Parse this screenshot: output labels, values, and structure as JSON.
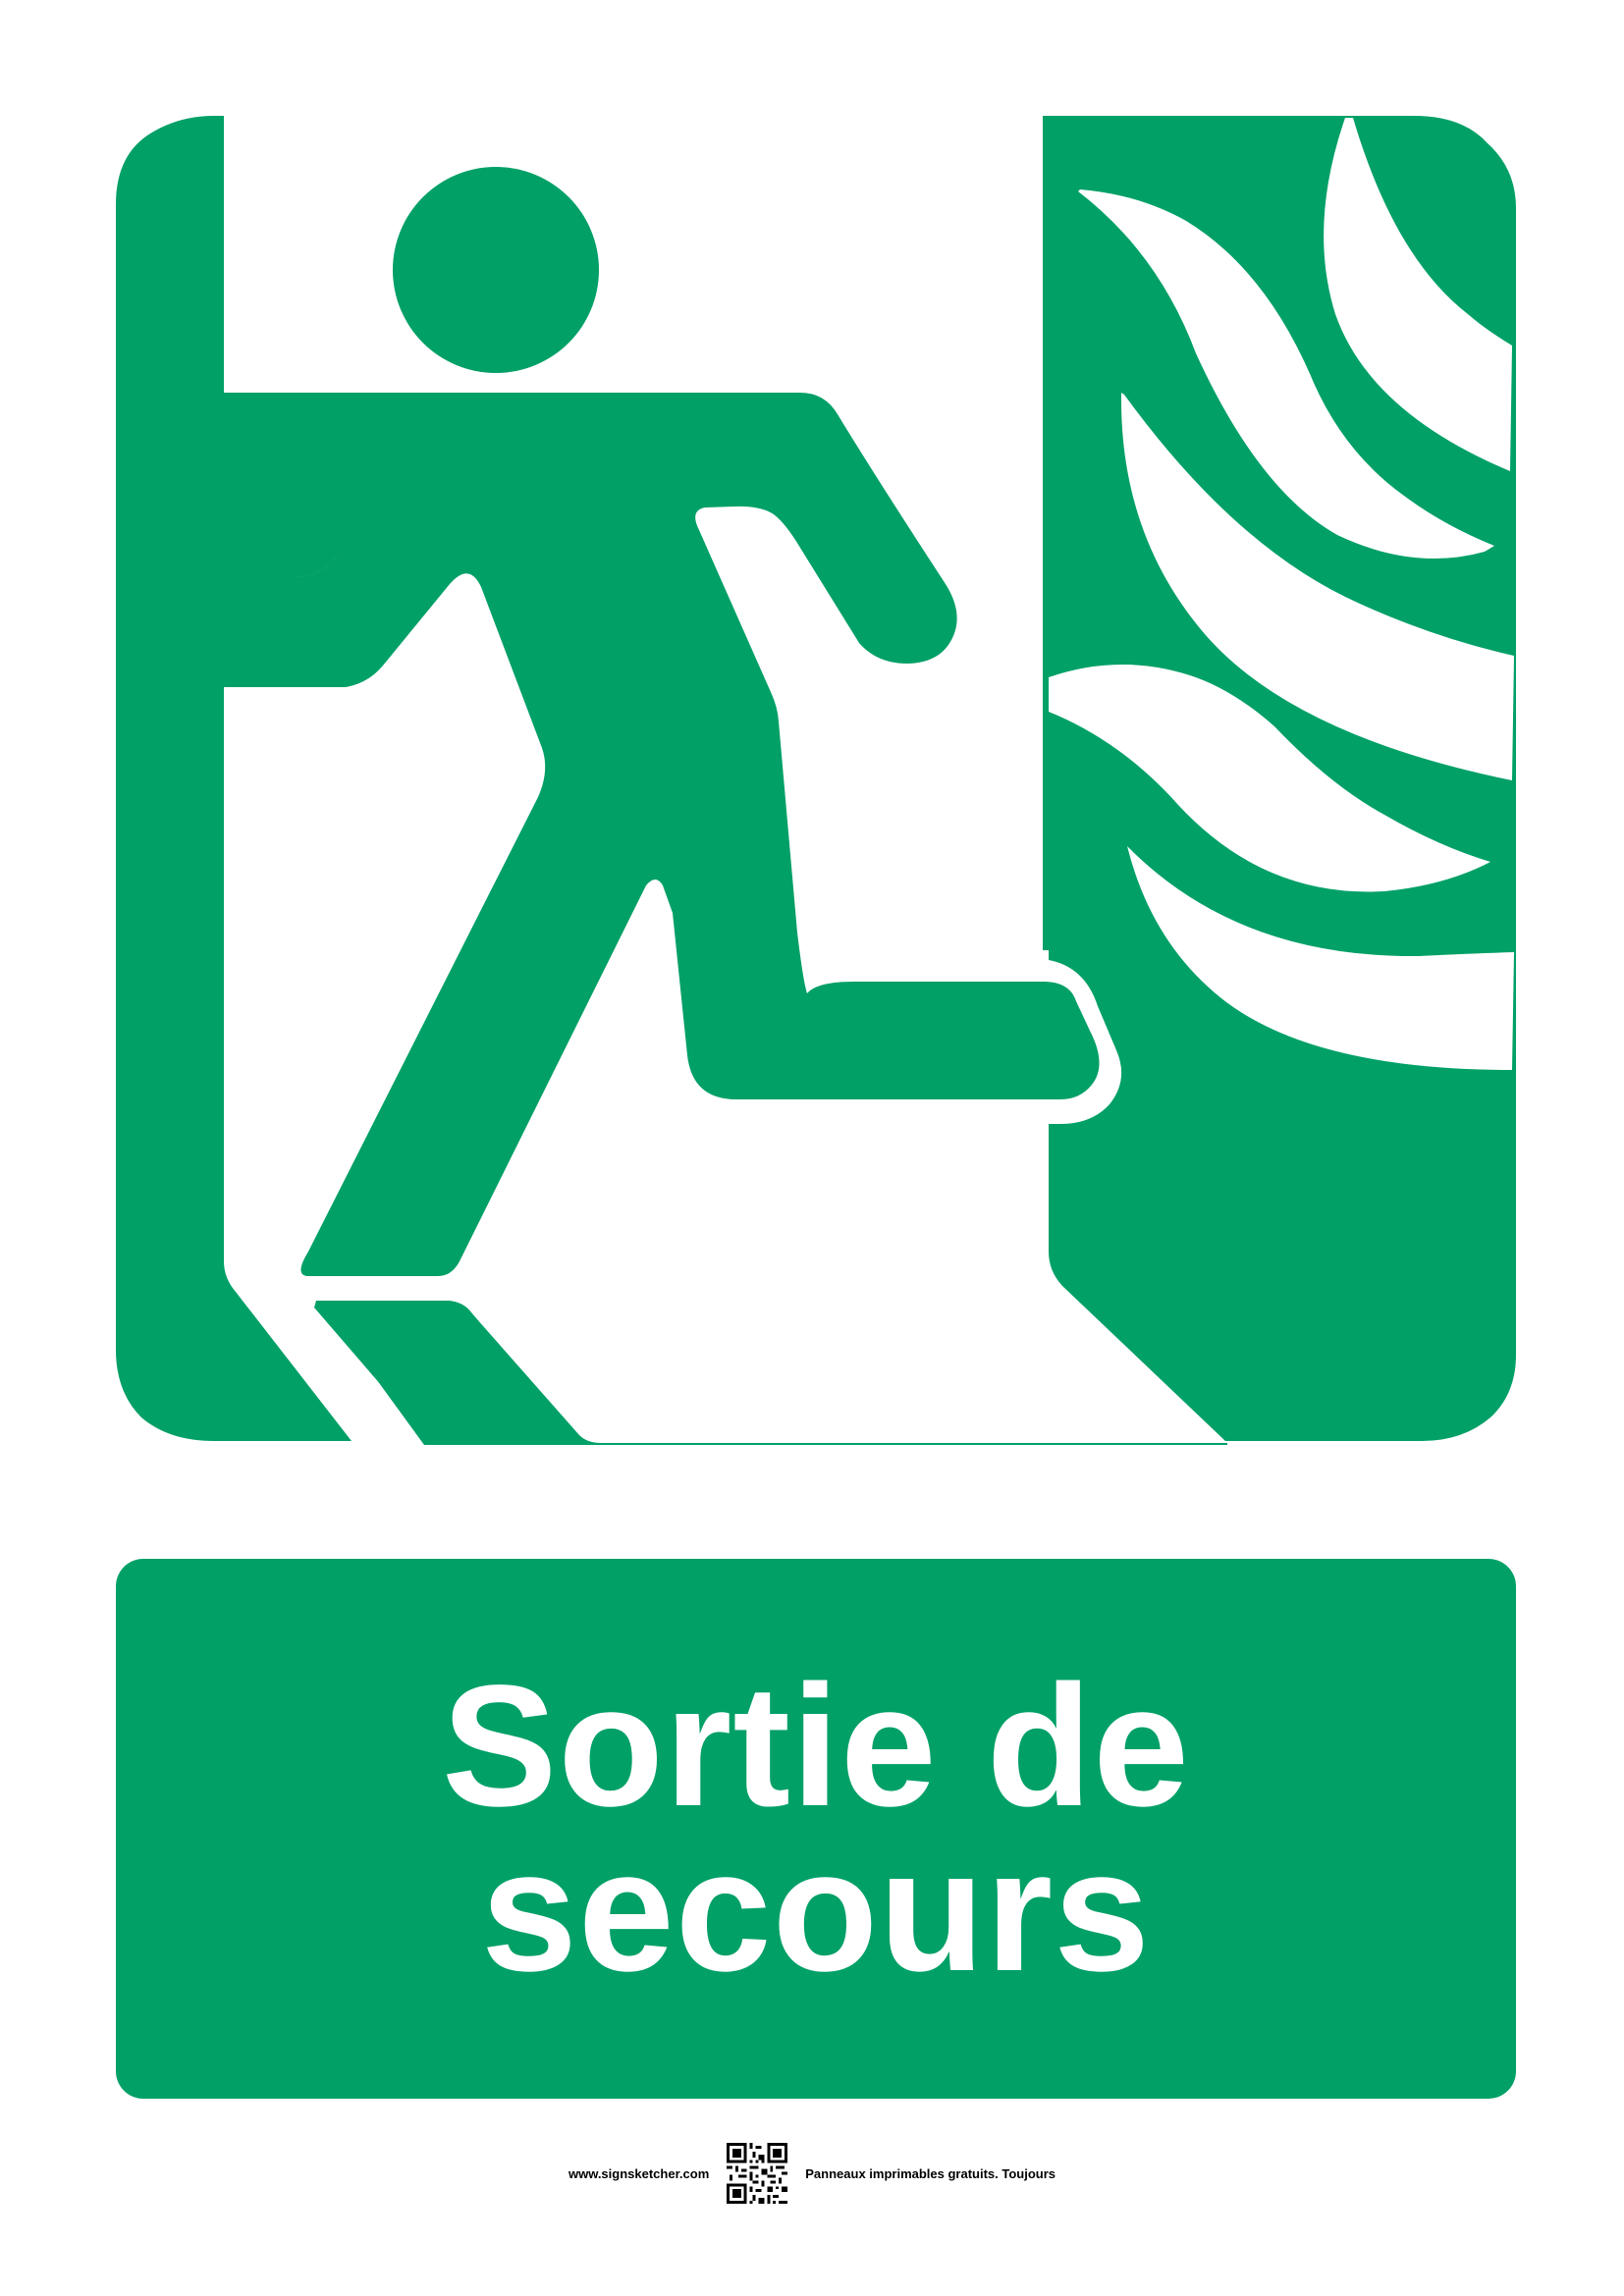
{
  "colors": {
    "sign_green": "#00a067",
    "background": "#ffffff",
    "text_on_green": "#ffffff",
    "footer_text": "#000000"
  },
  "sign": {
    "pictogram": "running-man-exit-left-with-fire-icon",
    "label_line1": "Sortie de",
    "label_line2": "secours"
  },
  "footer": {
    "website": "www.signsketcher.com",
    "qr": "qr-code-icon",
    "tagline": "Panneaux imprimables gratuits. Toujours"
  }
}
